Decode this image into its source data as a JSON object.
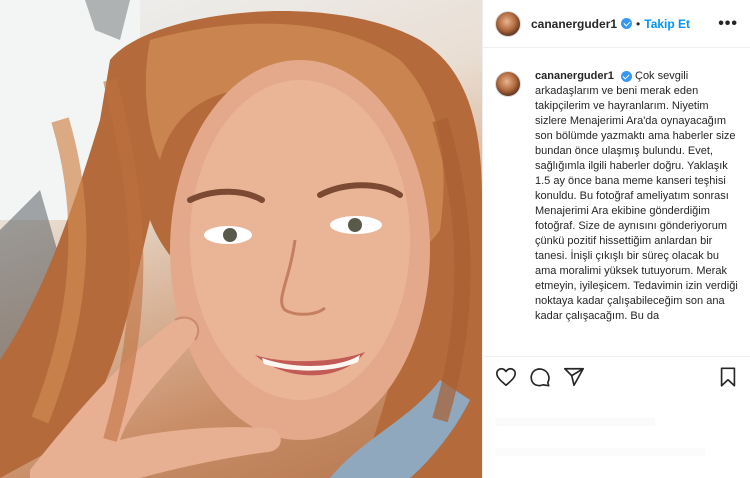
{
  "post": {
    "username": "cananerguder1",
    "verified_icon": "verified-badge-icon",
    "follow_separator": "•",
    "follow_label": "Takip Et",
    "more_label": "•••",
    "caption_username": "cananerguder1",
    "caption_text": "Çok sevgili arkadaşlarım ve beni merak eden takipçilerim ve hayranlarım. Niyetim sizlere Menajerimi Ara'da oynayacağım son bölümde yazmaktı ama haberler size bundan önce ulaşmış bulundu. Evet, sağlığımla ilgili haberler doğru. Yaklaşık 1.5 ay önce bana meme kanseri teşhisi konuldu. Bu fotoğraf ameliyatım sonrası Menajerimi Ara ekibine gönderdiğim fotoğraf. Size de aynısını gönderiyorum çünkü pozitif hissettiğim anlardan bir tanesi. İnişli çıkışlı bir süreç olacak bu ama moralimi yüksek tutuyorum. Merak etmeyin, iyileşicem. Tedavimin izin verdiği noktaya kadar çalışabileceğim son ana kadar çalışacağım. Bu da"
  },
  "actions": {
    "like_icon": "heart-icon",
    "comment_icon": "comment-icon",
    "share_icon": "share-icon",
    "save_icon": "bookmark-icon"
  },
  "colors": {
    "accent": "#0095f6",
    "verified": "#3897f0",
    "text": "#262626",
    "border": "#efefef"
  }
}
